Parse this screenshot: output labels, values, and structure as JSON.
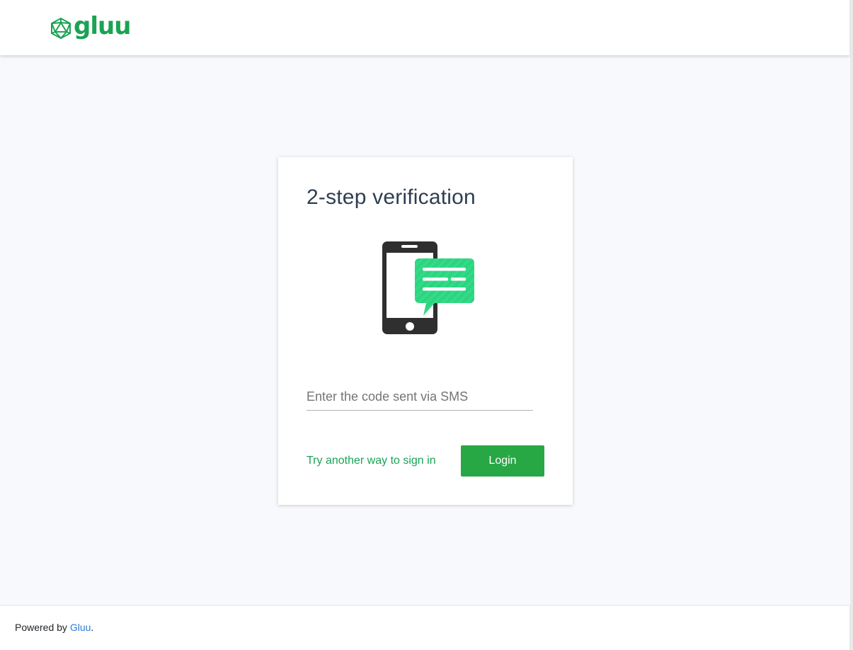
{
  "header": {
    "logo_text": "gluu",
    "logo_icon": "icosahedron-icon",
    "brand_color": "#1aa353"
  },
  "card": {
    "title": "2-step verification",
    "illustration": "phone-sms-icon",
    "code_input": {
      "placeholder": "Enter the code sent via SMS",
      "value": ""
    },
    "alt_link_label": "Try another way to sign in",
    "login_label": "Login",
    "button_color": "#28a745"
  },
  "footer": {
    "prefix": "Powered by ",
    "link_label": "Gluu",
    "suffix": "."
  }
}
